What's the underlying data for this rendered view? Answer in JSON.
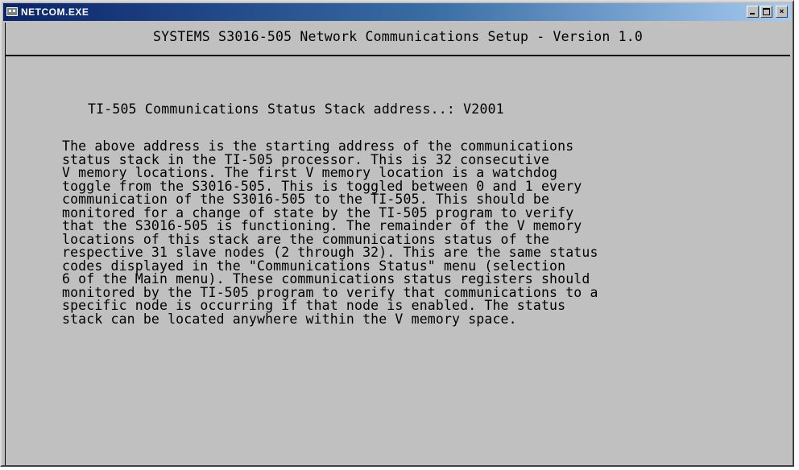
{
  "window": {
    "title": "NETCOM.EXE",
    "buttons": {
      "minimize": "_",
      "maximize": "□",
      "close": "×"
    }
  },
  "console": {
    "header": "SYSTEMS S3016-505 Network Communications Setup - Version 1.0",
    "status_label": "TI-505 Communications Status Stack address..: ",
    "status_value": "V2001",
    "help_lines": [
      "The above address is the starting address of the communications",
      "status stack in the TI-505 processor. This is 32 consecutive",
      "V memory locations. The first V memory location is a watchdog",
      "toggle from the S3016-505. This is toggled between 0 and 1 every",
      "communication of the S3016-505 to the TI-505. This should be",
      "monitored for a change of state by the TI-505 program to verify",
      "that the S3016-505 is functioning. The remainder of the V memory",
      "locations of this stack are the communications status of the",
      "respective 31 slave nodes (2 through 32). This are the same status",
      "codes displayed in the \"Communications Status\" menu (selection",
      "6 of the Main menu). These communications status registers should",
      "monitored by the TI-505 program to verify that communications to a",
      "specific node is occurring if that node is enabled. The status",
      "stack can be located anywhere within the V memory space."
    ]
  },
  "colors": {
    "titlebar_start": "#0a246a",
    "titlebar_end": "#a6caf0",
    "console_bg": "#c0c0c0",
    "console_fg": "#000000"
  }
}
